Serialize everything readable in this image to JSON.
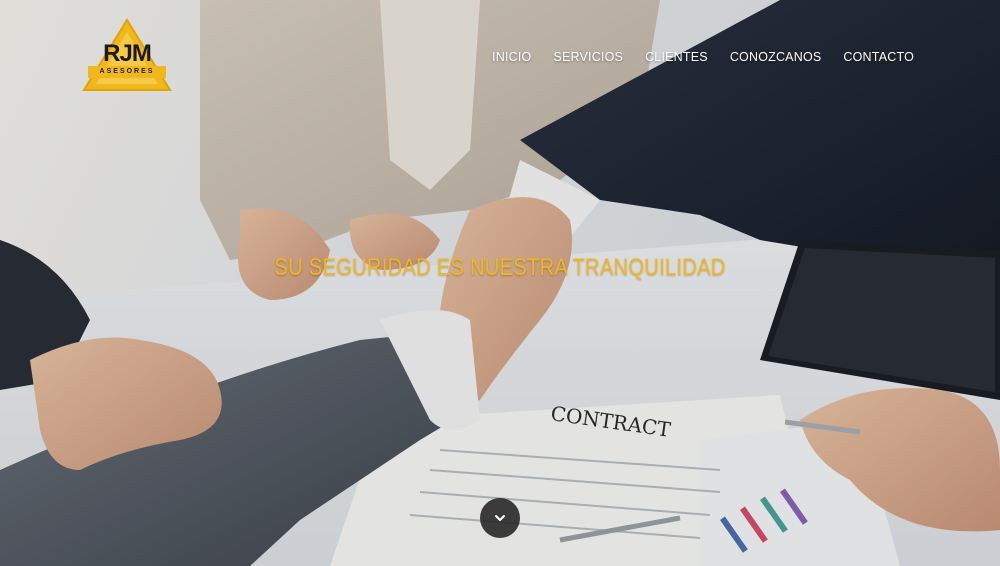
{
  "brand": {
    "logo_text": "RJM",
    "logo_subtext": "ASESORES",
    "accent_color": "#f2b71c"
  },
  "nav": {
    "items": [
      {
        "label": "INICIO"
      },
      {
        "label": "SERVICIOS"
      },
      {
        "label": "CLIENTES"
      },
      {
        "label": "CONOZCANOS"
      },
      {
        "label": "CONTACTO"
      }
    ]
  },
  "hero": {
    "tagline": "SU SEGURIDAD ES NUESTRA TRANQUILIDAD",
    "document_title": "CONTRACT",
    "scroll_icon": "chevron-down-icon"
  }
}
